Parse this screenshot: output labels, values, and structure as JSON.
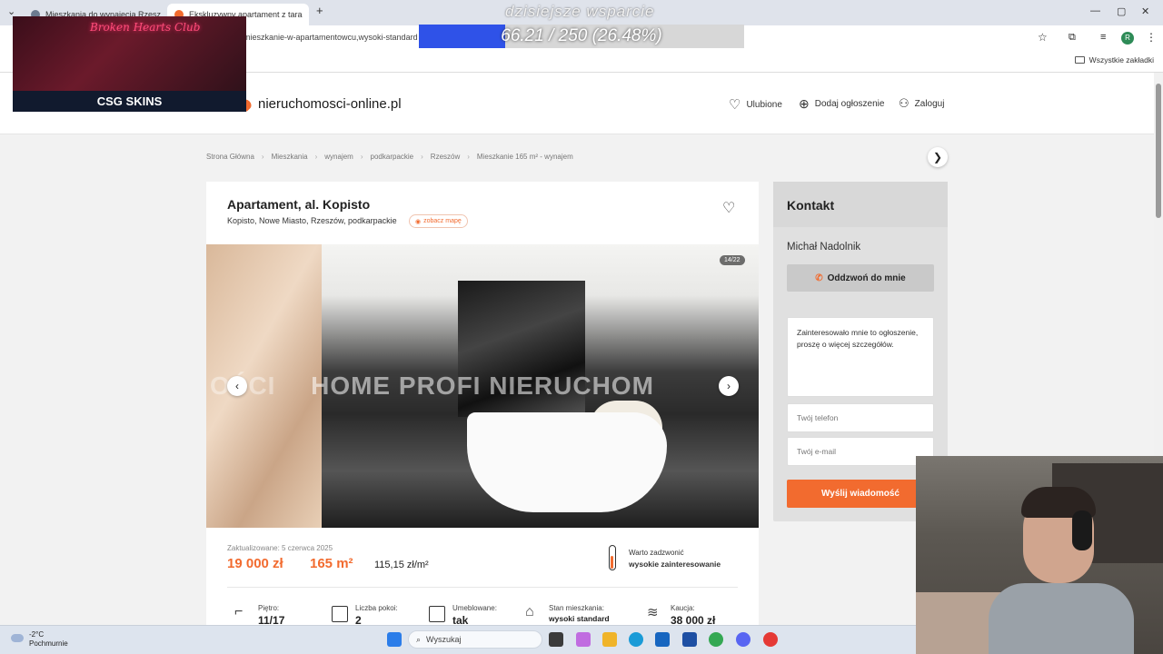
{
  "browser": {
    "tabs": [
      {
        "label": "Mieszkania do wynajęcia Rzesz"
      },
      {
        "label": "Ekskluzywny apartament z tara"
      }
    ],
    "url": "mieszkanie-w-apartamentowcu,wysoki-standard",
    "bookmarks_folder": "Wszystkie zakładki",
    "profile_initial": "R"
  },
  "site": {
    "logo": "nieruchomosci-online.pl",
    "nav": {
      "favorites": "Ulubione",
      "add_listing": "Dodaj ogłoszenie",
      "login": "Zaloguj"
    }
  },
  "breadcrumbs": [
    "Strona Główna",
    "Mieszkania",
    "wynajem",
    "podkarpackie",
    "Rzeszów",
    "Mieszkanie 165 m² - wynajem"
  ],
  "listing": {
    "title": "Apartament, al. Kopisto",
    "location": "Kopisto, Nowe Miasto, Rzeszów, podkarpackie",
    "map_link": "zobacz mapę",
    "photo_counter": "14/22",
    "watermark": "HOME PROFI NIERUCHOM",
    "watermark_left": "OŚCI",
    "updated": "Zaktualizowane: 5 czerwca 2025",
    "price": "19 000 zł",
    "area": "165 m²",
    "price_per_m2": "115,15 zł/m²",
    "interest_label": "Warto zadzwonić",
    "interest_value": "wysokie zainteresowanie",
    "params": [
      {
        "label": "Piętro:",
        "value": "11/17"
      },
      {
        "label": "Liczba pokoi:",
        "value": "2"
      },
      {
        "label": "Umeblowane:",
        "value": "tak"
      },
      {
        "label": "Stan mieszkania:",
        "value": "wysoki standard"
      },
      {
        "label": "Kaucja:",
        "value": "38 000 zł"
      }
    ]
  },
  "contact": {
    "title": "Kontakt",
    "agent": "Michał Nadolnik",
    "callback_button": "Oddzwoń do mnie",
    "message": "Zainteresowało mnie to ogłoszenie, proszę o więcej szczegółów.",
    "phone_placeholder": "Twój telefon",
    "email_placeholder": "Twój e-mail",
    "send_button": "Wyślij wiadomość"
  },
  "stream_overlay": {
    "sponsor_title": "Broken Hearts Club",
    "sponsor_brand": "CSG SKINS",
    "goal_label": "dzisiejsze wsparcie",
    "goal_text": "66.21 / 250 (26.48%)",
    "goal_fraction": 0.2648
  },
  "taskbar": {
    "temperature": "-2°C",
    "weather": "Pochmurnie",
    "search_label": "Wyszukaj"
  },
  "colors": {
    "accent": "#f26b2f",
    "progress": "#2f52e8"
  }
}
